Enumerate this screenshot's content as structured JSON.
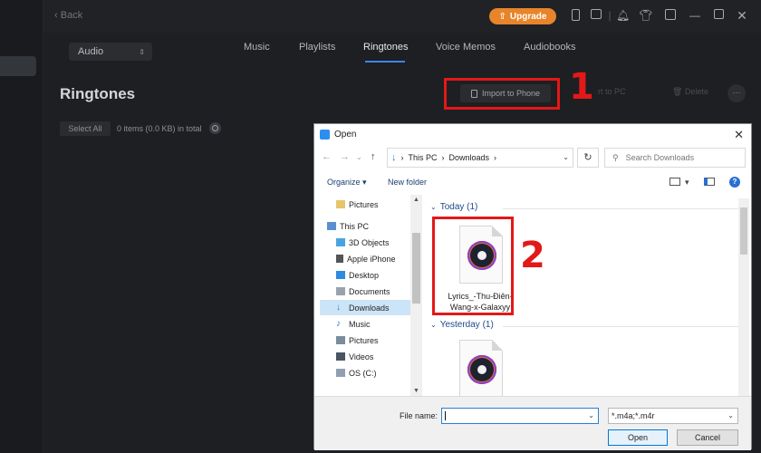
{
  "topbar": {
    "back_label": "Back",
    "upgrade_label": "Upgrade",
    "icons": [
      "phone-icon",
      "gift-icon",
      "bell-icon",
      "shirt-icon",
      "menu-box-icon",
      "minimize-icon",
      "restore-icon",
      "close-icon"
    ]
  },
  "nav": {
    "device_select": "Audio",
    "tabs": [
      {
        "label": "Music"
      },
      {
        "label": "Playlists"
      },
      {
        "label": "Ringtones",
        "active": true
      },
      {
        "label": "Voice Memos"
      },
      {
        "label": "Audiobooks"
      }
    ]
  },
  "page": {
    "title": "Ringtones",
    "select_all_label": "Select All",
    "count_text": "0 items (0.0 KB) in total",
    "import_button": "Import to Phone",
    "export_button_partial": "rt to PC",
    "delete_button": "Delete",
    "more_label": "···"
  },
  "annotations": {
    "one": "1",
    "two": "2",
    "color": "#e31818"
  },
  "dialog": {
    "title": "Open",
    "breadcrumb": [
      "This PC",
      "Downloads"
    ],
    "search_placeholder": "Search Downloads",
    "organize_label": "Organize ▾",
    "new_folder_label": "New folder",
    "help_label": "?",
    "nav_items": [
      {
        "label": "Pictures"
      },
      {
        "label": "This PC"
      },
      {
        "label": "3D Objects"
      },
      {
        "label": "Apple iPhone"
      },
      {
        "label": "Desktop"
      },
      {
        "label": "Documents"
      },
      {
        "label": "Downloads",
        "selected": true
      },
      {
        "label": "Music"
      },
      {
        "label": "Pictures"
      },
      {
        "label": "Videos"
      },
      {
        "label": "OS (C:)"
      }
    ],
    "groups": [
      {
        "header": "Today (1)",
        "files": [
          {
            "name": "Lyrics_-Thu-Điên-Wang-x-Galaxyy"
          }
        ]
      },
      {
        "header": "Yesterday (1)",
        "files": [
          {
            "name": ""
          }
        ]
      }
    ],
    "file_name_label": "File name:",
    "file_name_value": "",
    "file_type": "*.m4a;*.m4r",
    "open_button": "Open",
    "cancel_button": "Cancel"
  },
  "colors": {
    "accent": "#3b86f7",
    "upgrade": "#e8842a",
    "selection": "#cce4f7"
  }
}
